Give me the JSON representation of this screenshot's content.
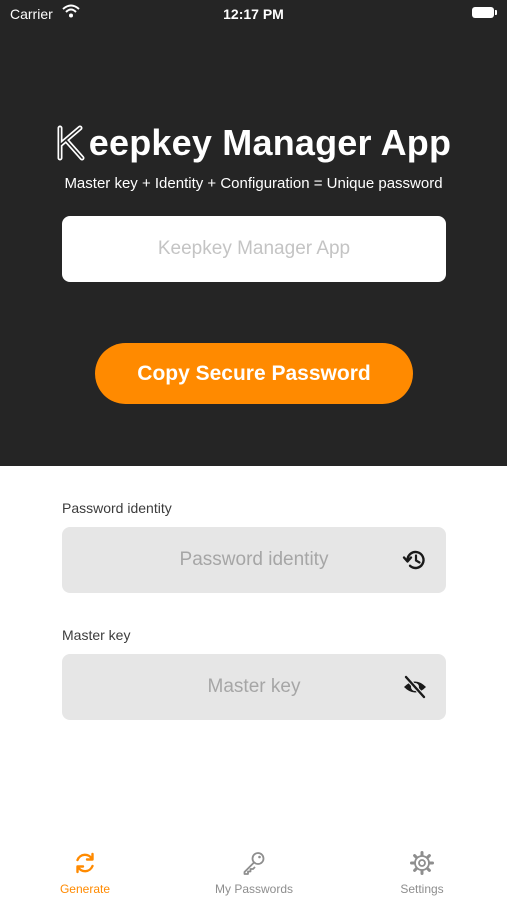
{
  "status_bar": {
    "carrier": "Carrier",
    "time": "12:17 PM"
  },
  "header": {
    "title_rest": "eepkey Manager App",
    "subtitle": "Master key + Identity + Configuration = Unique password",
    "output_placeholder": "Keepkey Manager App",
    "copy_button_label": "Copy Secure Password"
  },
  "form": {
    "identity_label": "Password identity",
    "identity_placeholder": "Password identity",
    "master_label": "Master key",
    "master_placeholder": "Master key"
  },
  "tabs": [
    {
      "label": "Generate",
      "icon": "refresh-icon",
      "active": true
    },
    {
      "label": "My Passwords",
      "icon": "key-icon",
      "active": false
    },
    {
      "label": "Settings",
      "icon": "gear-icon",
      "active": false
    }
  ],
  "colors": {
    "accent": "#ff8a00",
    "header_bg": "#252525",
    "field_bg": "#e6e6e6"
  }
}
